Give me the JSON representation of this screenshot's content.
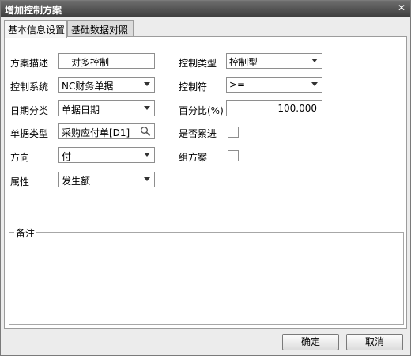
{
  "window": {
    "title": "增加控制方案",
    "close_label": "✕"
  },
  "tabs": [
    {
      "label": "基本信息设置",
      "active": true
    },
    {
      "label": "基础数据对照",
      "active": false
    }
  ],
  "form": {
    "description": {
      "label": "方案描述",
      "value": "一对多控制"
    },
    "control_system": {
      "label": "控制系统",
      "value": "NC财务单据"
    },
    "date_category": {
      "label": "日期分类",
      "value": "单据日期"
    },
    "document_type": {
      "label": "单据类型",
      "value": "采购应付单[D1]"
    },
    "direction": {
      "label": "方向",
      "value": "付"
    },
    "attribute": {
      "label": "属性",
      "value": "发生额"
    },
    "control_type": {
      "label": "控制类型",
      "value": "控制型"
    },
    "control_operator": {
      "label": "控制符",
      "value": ">="
    },
    "percentage": {
      "label": "百分比(%)",
      "value": "100.000"
    },
    "cumulative": {
      "label": "是否累进",
      "checked": false
    },
    "group_scheme": {
      "label": "组方案",
      "checked": false
    }
  },
  "remarks": {
    "label": "备注",
    "value": ""
  },
  "buttons": {
    "ok": "确定",
    "cancel": "取消"
  }
}
